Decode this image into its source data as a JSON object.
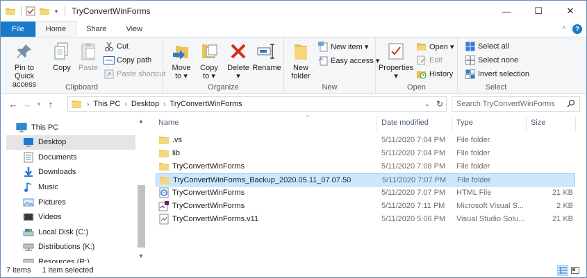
{
  "window": {
    "title": "TryConvertWinForms",
    "minimize_label": "—",
    "maximize_label": "☐",
    "close_label": "✕"
  },
  "tabs": {
    "file": "File",
    "home": "Home",
    "share": "Share",
    "view": "View",
    "collapse": "^",
    "help": "?"
  },
  "ribbon": {
    "clipboard": {
      "group": "Clipboard",
      "pin": "Pin to Quick access",
      "copy": "Copy",
      "paste": "Paste",
      "cut": "Cut",
      "copy_path": "Copy path",
      "paste_shortcut": "Paste shortcut"
    },
    "organize": {
      "group": "Organize",
      "move_to": "Move to",
      "copy_to": "Copy to",
      "delete": "Delete",
      "rename": "Rename"
    },
    "new": {
      "group": "New",
      "new_folder": "New folder",
      "new_item": "New item",
      "easy_access": "Easy access"
    },
    "open": {
      "group": "Open",
      "properties": "Properties",
      "open": "Open",
      "edit": "Edit",
      "history": "History"
    },
    "select": {
      "group": "Select",
      "select_all": "Select all",
      "select_none": "Select none",
      "invert": "Invert selection"
    }
  },
  "address": {
    "crumbs": [
      "This PC",
      "Desktop",
      "TryConvertWinForms"
    ],
    "search_placeholder": "Search TryConvertWinForms"
  },
  "nav_pane": {
    "items": [
      {
        "label": "This PC",
        "icon": "pc-icon"
      },
      {
        "label": "Desktop",
        "icon": "desktop-icon",
        "selected": true
      },
      {
        "label": "Documents",
        "icon": "documents-icon"
      },
      {
        "label": "Downloads",
        "icon": "downloads-icon"
      },
      {
        "label": "Music",
        "icon": "music-icon"
      },
      {
        "label": "Pictures",
        "icon": "pictures-icon"
      },
      {
        "label": "Videos",
        "icon": "videos-icon"
      },
      {
        "label": "Local Disk (C:)",
        "icon": "drive-icon"
      },
      {
        "label": "Distributions (K:)",
        "icon": "network-drive-icon"
      },
      {
        "label": "Resources (R:)",
        "icon": "network-drive-icon"
      }
    ]
  },
  "file_list": {
    "columns": {
      "name": "Name",
      "date": "Date modified",
      "type": "Type",
      "size": "Size"
    },
    "rows": [
      {
        "name": ".vs",
        "date": "5/11/2020 7:04 PM",
        "type": "File folder",
        "size": "",
        "icon": "folder-icon"
      },
      {
        "name": "lib",
        "date": "5/11/2020 7:04 PM",
        "type": "File folder",
        "size": "",
        "icon": "folder-icon"
      },
      {
        "name": "TryConvertWinForms",
        "date": "5/11/2020 7:08 PM",
        "type": "File folder",
        "size": "",
        "icon": "folder-icon"
      },
      {
        "name": "TryConvertWinForms_Backup_2020.05.11_07.07.50",
        "date": "5/11/2020 7:07 PM",
        "type": "File folder",
        "size": "",
        "icon": "folder-icon",
        "selected": true
      },
      {
        "name": "TryConvertWinForms",
        "date": "5/11/2020 7:07 PM",
        "type": "HTML File",
        "size": "21 KB",
        "icon": "html-file-icon"
      },
      {
        "name": "TryConvertWinForms",
        "date": "5/11/2020 7:11 PM",
        "type": "Microsoft Visual S...",
        "size": "2 KB",
        "icon": "vs-solution-icon"
      },
      {
        "name": "TryConvertWinForms.v11",
        "date": "5/11/2020 5:06 PM",
        "type": "Visual Studio Solu...",
        "size": "21 KB",
        "icon": "vs-suo-icon"
      }
    ]
  },
  "status": {
    "count": "7 items",
    "selection": "1 item selected"
  },
  "colors": {
    "accent": "#1979ca",
    "selection": "#cce8ff",
    "folder": "#e8c35a"
  }
}
